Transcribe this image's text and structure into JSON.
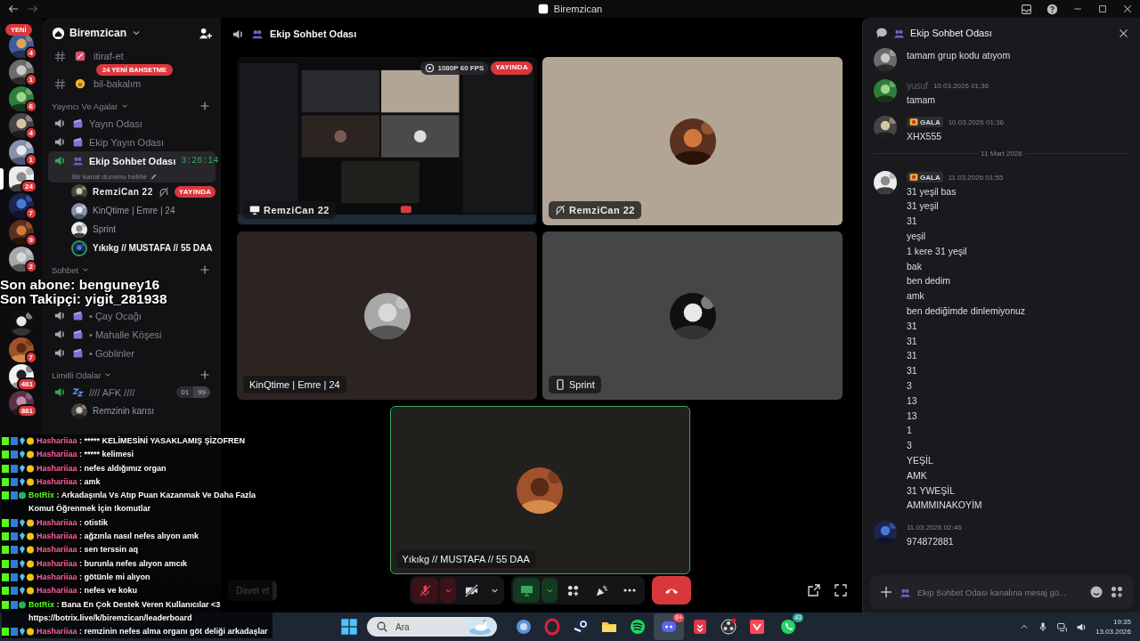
{
  "title_bar": {
    "title": "Biremzican"
  },
  "server_rail": {
    "new_label": "YENİ",
    "servers": [
      {
        "badge": "4",
        "selected": false
      },
      {
        "badge": "1",
        "selected": false
      },
      {
        "badge": "6",
        "selected": false
      },
      {
        "badge": "4",
        "selected": false
      },
      {
        "badge": "1",
        "selected": false
      },
      {
        "badge": "24",
        "selected": true
      },
      {
        "badge": "7",
        "selected": false
      },
      {
        "badge": "9",
        "selected": false
      },
      {
        "badge": "2",
        "selected": false
      },
      {
        "selected": false
      },
      {
        "badge": "7",
        "selected": false
      },
      {
        "badge": "481",
        "selected": false
      },
      {
        "badge": "881",
        "selected": false
      }
    ]
  },
  "sidebar": {
    "server_name": "Biremzican",
    "mentions_pill": "24 YENİ BAHSETME",
    "items": [
      {
        "kind": "text",
        "name": "itiraf-et"
      },
      {
        "kind": "text",
        "name": "bil-bakalım"
      },
      {
        "kind": "category",
        "name": "Yayıncı Ve Agalar"
      },
      {
        "kind": "voice",
        "name": "Yayın Odası",
        "selected": false
      },
      {
        "kind": "voice",
        "name": "Ekip Yayın Odası",
        "selected": false
      },
      {
        "kind": "voice",
        "name": "Ekip Sohbet Odası",
        "selected": true,
        "timer": "3:26:14",
        "status": "Bir kanal durumu belirle",
        "children": [
          {
            "name": "RemziCan 22",
            "live": "YAYINDA",
            "speaking": false
          },
          {
            "name": "KinQtime | Emre | 24",
            "speaking": false
          },
          {
            "name": "Sprint",
            "speaking": false
          },
          {
            "name": "Yıkıkg // MUSTAFA // 55 DAA",
            "speaking": true
          }
        ]
      },
      {
        "kind": "category",
        "name": "Sohbet"
      },
      {
        "kind": "voice",
        "name": "• Çay Ocağı",
        "selected": false
      },
      {
        "kind": "voice",
        "name": "• Mahalle Köşesi",
        "selected": false
      },
      {
        "kind": "voice",
        "name": "• Goblinler",
        "selected": false
      },
      {
        "kind": "category",
        "name": "Limitli Odalar"
      },
      {
        "kind": "voice",
        "name": "//// AFK ////",
        "selected": false,
        "limit": [
          "01",
          "99"
        ],
        "children": [
          {
            "name": "Remzinin karısı",
            "speaking": false
          }
        ]
      }
    ]
  },
  "call": {
    "title": "Ekip Sohbet Odası",
    "tiles": [
      {
        "kind": "screen",
        "name": "RemziCan 22",
        "quality": "1080P 60 FPS",
        "live": "YAYINDA",
        "speaking": false,
        "color": "#0e0e10"
      },
      {
        "kind": "avatar",
        "name": "RemziCan 22",
        "muted": true,
        "speaking": false,
        "color": "#b2a595"
      },
      {
        "kind": "avatar",
        "name": "KinQtime | Emre | 24",
        "speaking": false,
        "color": "#2b2421"
      },
      {
        "kind": "avatar",
        "name": "Sprint",
        "mobile": true,
        "speaking": false,
        "color": "#464646"
      },
      {
        "kind": "avatar",
        "name": "Yıkıkg // MUSTAFA // 55 DAA",
        "speaking": true,
        "color": "#22201d"
      }
    ],
    "invite": "Davet et",
    "controls": {
      "mic_muted": true,
      "camera_off": true,
      "screen_sharing": true
    }
  },
  "chat": {
    "title": "Ekip Sohbet Odası",
    "items": [
      {
        "kind": "message",
        "lines": [
          "tamam grup kodu atıyom"
        ]
      },
      {
        "kind": "message",
        "author": "yusuf",
        "time": "10.03.2026 01:36",
        "lines": [
          "tamam"
        ]
      },
      {
        "kind": "message",
        "badge": "GALA",
        "time": "10.03.2026 01:36",
        "lines": [
          "XHX555"
        ]
      },
      {
        "kind": "divider",
        "text": "11 Mart 2026"
      },
      {
        "kind": "message",
        "badge": "GALA",
        "time": "11.03.2026 01:55",
        "lines": [
          "31 yeşil bas",
          "31 yeşil",
          "31",
          "yeşil",
          "1 kere 31 yeşil",
          "bak",
          "ben dedim",
          "amk",
          "ben dediğimde dinlemiyonuz",
          "31",
          "31",
          "31",
          "31",
          "3",
          "13",
          "13",
          "1",
          "3",
          "YEŞİL",
          "AMK",
          "31 YWEŞİL",
          "AMMMINAKOYİM"
        ]
      },
      {
        "kind": "message",
        "time": "11.03.2026 02:46",
        "lines": [
          "974872881"
        ]
      }
    ],
    "placeholder": "Ekip Sohbet Odası kanalına mesaj gö..."
  },
  "taskbar": {
    "search_placeholder": "Ara",
    "apps": [
      {
        "kind": "orb",
        "selected": false
      },
      {
        "kind": "ring",
        "selected": false
      },
      {
        "kind": "disc",
        "selected": false
      },
      {
        "kind": "folder",
        "selected": false
      },
      {
        "kind": "wave",
        "selected": false
      },
      {
        "kind": "chat",
        "selected": true,
        "badge": "9+"
      },
      {
        "kind": "shield",
        "selected": false
      },
      {
        "kind": "record",
        "selected": false
      },
      {
        "kind": "check",
        "selected": false
      },
      {
        "kind": "phone",
        "selected": false,
        "badge": "43"
      }
    ],
    "clock": {
      "time": "19:35",
      "date": "13.03.2026"
    }
  },
  "stream_overlay": {
    "recent": [
      "Son abone: benguney16",
      "Son Takipçi: yigit_281938"
    ],
    "chat": [
      {
        "kind": "viewer",
        "user": "Hashariiaa",
        "text": ": ***** KELİMESİNİ YASAKLAMIŞ ŞİZOFREN"
      },
      {
        "kind": "viewer",
        "user": "Hashariiaa",
        "text": ": ***** kelimesi"
      },
      {
        "kind": "viewer",
        "user": "Hashariiaa",
        "text": ": nefes aldığımız organ"
      },
      {
        "kind": "viewer",
        "user": "Hashariiaa",
        "text": ": amk"
      },
      {
        "kind": "bot",
        "user": "BotRix",
        "text": ": Arkadaşınla Vs Atıp Puan Kazanmak Ve Daha Fazla Komut Öğrenmek İçin !komutlar"
      },
      {
        "kind": "viewer",
        "user": "Hashariiaa",
        "text": ": otistik"
      },
      {
        "kind": "viewer",
        "user": "Hashariiaa",
        "text": ": ağzınla nasıl nefes alıyon amk"
      },
      {
        "kind": "viewer",
        "user": "Hashariiaa",
        "text": ": sen terssin aq"
      },
      {
        "kind": "viewer",
        "user": "Hashariiaa",
        "text": ": burunla nefes alıyon amcık"
      },
      {
        "kind": "viewer",
        "user": "Hashariiaa",
        "text": ": götünle mi alıyon"
      },
      {
        "kind": "viewer",
        "user": "Hashariiaa",
        "text": ": nefes ve koku"
      },
      {
        "kind": "bot",
        "user": "BotRix",
        "text": ": Bana En Çok Destek Veren Kullanıcılar <3 https://botrix.live/k/biremzican/leaderboard"
      },
      {
        "kind": "viewer",
        "user": "Hashariiaa",
        "text": ": remzinin nefes alma organı göt deliği arkadaşlar"
      }
    ]
  }
}
